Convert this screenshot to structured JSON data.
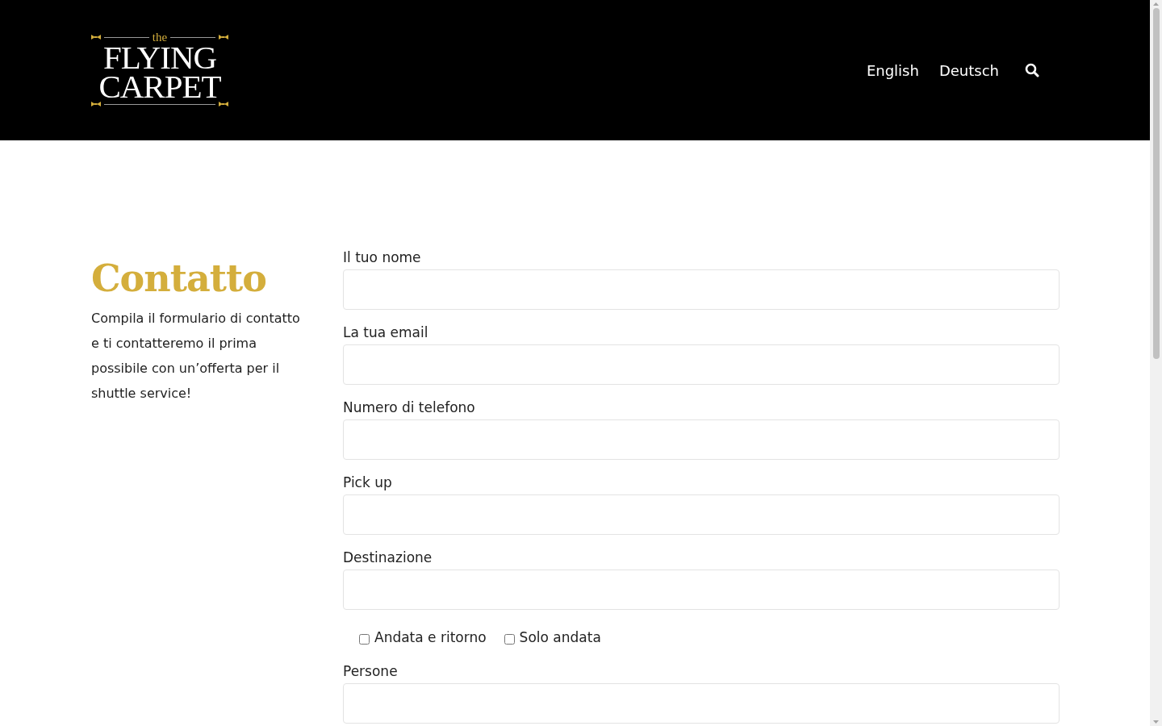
{
  "header": {
    "logo": {
      "small": "the",
      "line1": "FLYING",
      "line2": "CARPET"
    },
    "nav": [
      {
        "label": "English"
      },
      {
        "label": "Deutsch"
      }
    ]
  },
  "intro": {
    "title": "Contatto",
    "text": "Compila il formulario di contatto e ti contatteremo il prima possibile con un’offerta per il shuttle service!"
  },
  "form": {
    "fields": [
      {
        "label": "Il tuo nome"
      },
      {
        "label": "La tua email"
      },
      {
        "label": "Numero di telefono"
      },
      {
        "label": "Pick up"
      },
      {
        "label": "Destinazione"
      }
    ],
    "options": [
      {
        "label": "Andata e ritorno",
        "checked": false
      },
      {
        "label": "Solo andata",
        "checked": false
      }
    ],
    "last_field": {
      "label": "Persone"
    }
  }
}
